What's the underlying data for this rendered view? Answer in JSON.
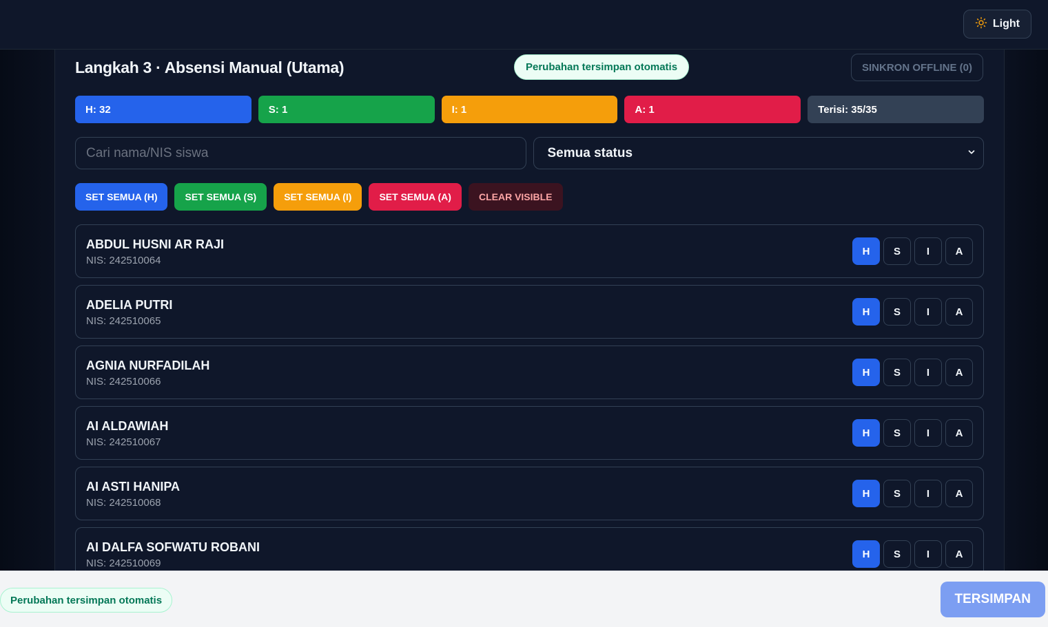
{
  "header": {
    "theme_label": "Light",
    "theme_icon": "sun-icon"
  },
  "panel": {
    "title": "Langkah 3 · Absensi Manual (Utama)",
    "autosave_text": "Perubahan tersimpan otomatis",
    "sync_label": "SINKRON OFFLINE (0)"
  },
  "stats": [
    {
      "label": "H: 32",
      "color": "#2563eb"
    },
    {
      "label": "S: 1",
      "color": "#16a34a"
    },
    {
      "label": "I: 1",
      "color": "#f59e0b"
    },
    {
      "label": "A: 1",
      "color": "#e11d48"
    },
    {
      "label": "Terisi: 35/35",
      "color": "#334155"
    }
  ],
  "filters": {
    "search_placeholder": "Cari nama/NIS siswa",
    "status_selected": "Semua status"
  },
  "actions": [
    {
      "label": "SET SEMUA (H)",
      "color": "#2563eb"
    },
    {
      "label": "SET SEMUA (S)",
      "color": "#16a34a"
    },
    {
      "label": "SET SEMUA (I)",
      "color": "#f59e0b"
    },
    {
      "label": "SET SEMUA (A)",
      "color": "#e11d48"
    },
    {
      "label": "CLEAR VISIBLE",
      "color": "#3b1320",
      "text_color": "#fca5a5"
    }
  ],
  "status_options": [
    "H",
    "S",
    "I",
    "A"
  ],
  "students": [
    {
      "name": "ABDUL HUSNI AR RAJI",
      "nis": "NIS: 242510064",
      "status": "H"
    },
    {
      "name": "ADELIA PUTRI",
      "nis": "NIS: 242510065",
      "status": "H"
    },
    {
      "name": "AGNIA NURFADILAH",
      "nis": "NIS: 242510066",
      "status": "H"
    },
    {
      "name": "AI ALDAWIAH",
      "nis": "NIS: 242510067",
      "status": "H"
    },
    {
      "name": "AI ASTI HANIPA",
      "nis": "NIS: 242510068",
      "status": "H"
    },
    {
      "name": "AI DALFA SOFWATU ROBANI",
      "nis": "NIS: 242510069",
      "status": "H"
    }
  ],
  "footer": {
    "autosave_text": "Perubahan tersimpan otomatis",
    "save_label": "TERSIMPAN"
  }
}
